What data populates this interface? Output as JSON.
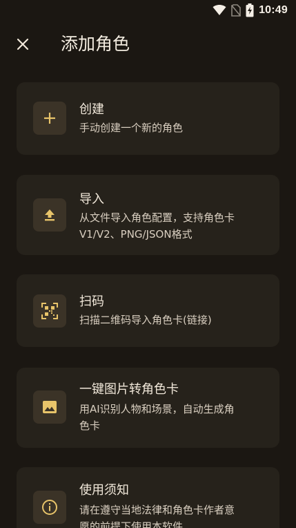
{
  "status_bar": {
    "time": "10:49",
    "icons": [
      "wifi-icon",
      "no-sim-icon",
      "battery-charging-icon"
    ]
  },
  "app_bar": {
    "close_icon": "close-icon",
    "title": "添加角色"
  },
  "colors": {
    "background": "#1b1712",
    "card": "#26221b",
    "icon_box": "#3b3327",
    "accent_gold": "#e8c46a",
    "text_primary": "#f1e8da",
    "text_secondary": "#d9cfc0"
  },
  "options": [
    {
      "icon": "plus-icon",
      "title": "创建",
      "desc_lines": [
        "手动创建一个新的角色"
      ]
    },
    {
      "icon": "upload-icon",
      "title": "导入",
      "desc_lines": [
        "从文件导入角色配置，支持角色卡",
        "V1/V2、PNG/JSON格式"
      ]
    },
    {
      "icon": "qr-scan-icon",
      "title": "扫码",
      "desc_lines": [
        "扫描二维码导入角色卡(链接)"
      ]
    },
    {
      "icon": "image-icon",
      "title": "一键图片转角色卡",
      "desc_lines": [
        "用AI识别人物和场景，自动生成角",
        "色卡"
      ]
    },
    {
      "icon": "info-icon",
      "title": "使用须知",
      "desc_lines": [
        "请在遵守当地法律和角色卡作者意",
        "愿的前提下使用本软件"
      ]
    }
  ]
}
